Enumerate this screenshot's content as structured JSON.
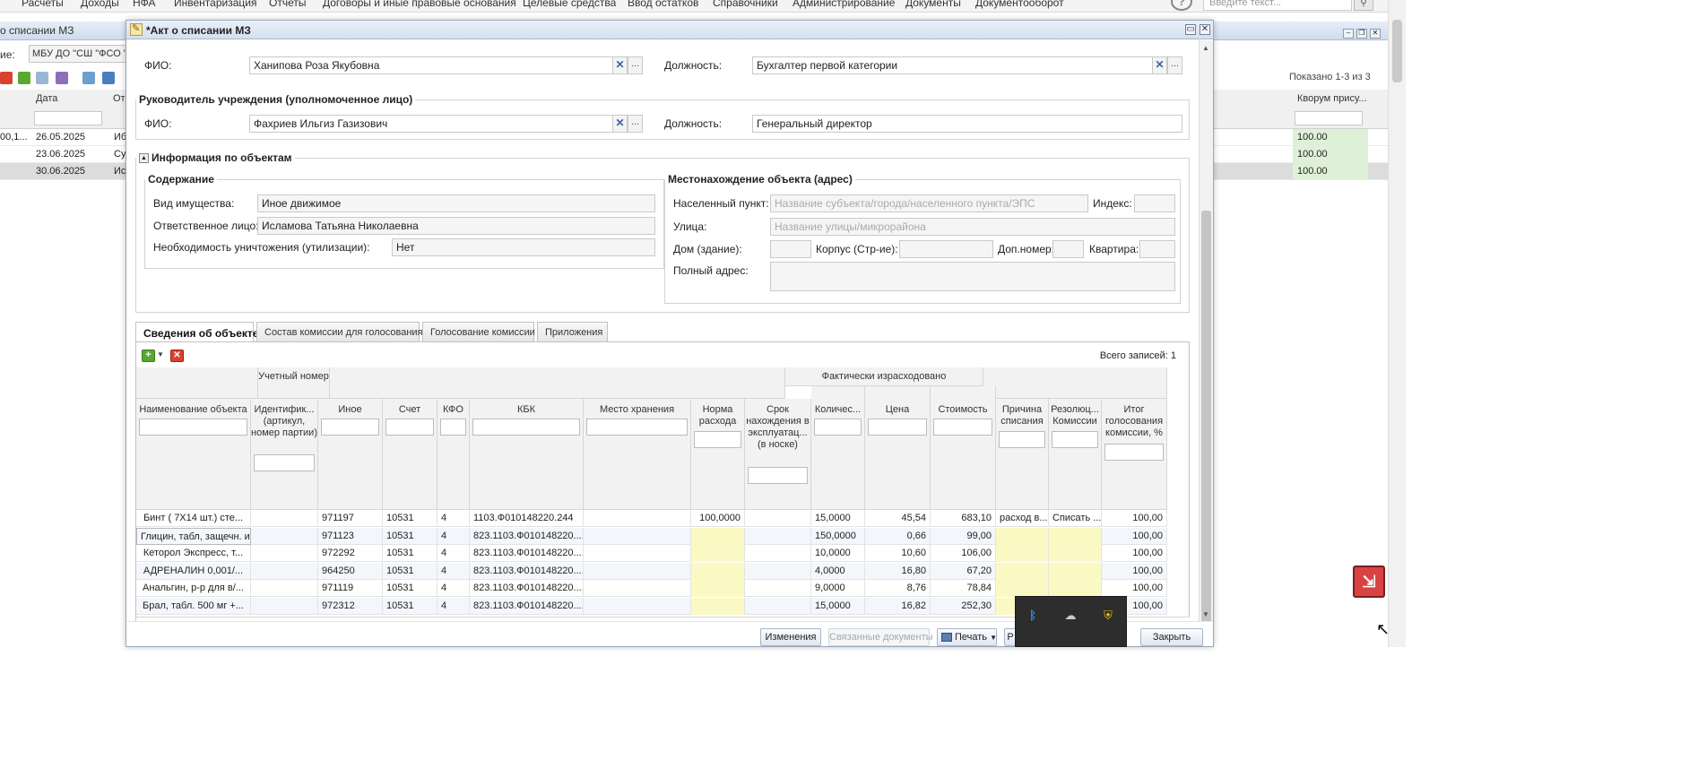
{
  "app": {
    "menu": [
      "Расчеты",
      "Доходы",
      "НФА",
      "Инвентаризация",
      "Отчеты",
      "Договоры и иные правовые основания",
      "Целевые средства",
      "Ввод остатков",
      "Справочники",
      "Администрирование",
      "Документы",
      "Документооборот"
    ],
    "help_icon": "?",
    "search_placeholder": "Введите текст...",
    "search_icon": "magnifier",
    "window_title": "о списании МЗ",
    "filter_label": "ие:",
    "filter_value": "МБУ ДО \"СШ \"ФСО \"",
    "shown_text": "Показано 1-3 из 3",
    "grid_headers": [
      "Дата",
      "От",
      "Кворум прису..."
    ],
    "rows": [
      {
        "c0": "00,1...",
        "date": "26.05.2025",
        "from": "Иб",
        "quorum": "100.00"
      },
      {
        "c0": "",
        "date": "23.06.2025",
        "from": "Су",
        "quorum": "100.00"
      },
      {
        "c0": "",
        "date": "30.06.2025",
        "from": "Ис",
        "quorum": "100.00"
      }
    ],
    "tray_app_icon": "app-icon"
  },
  "dialog": {
    "title": "*Акт о списании МЗ",
    "fio_label": "ФИО:",
    "position_label": "Должность:",
    "member": {
      "fio": "Ханипова Роза Якубовна",
      "position": "Бухгалтер первой категории"
    },
    "head_legend": "Руководитель учреждения (уполномоченное лицо)",
    "head": {
      "fio": "Фахриев Ильгиз Газизович",
      "position": "Генеральный директор"
    },
    "clear_symbol": "✕",
    "dots_symbol": "...",
    "info_legend": "Информация по объектам",
    "content": {
      "legend": "Содержание",
      "property_type_label": "Вид имущества:",
      "property_type": "Иное движимое",
      "responsible_label": "Ответственное лицо:",
      "responsible": "Исламова Татьяна Николаевна",
      "destroy_label": "Необходимость уничтожения (утилизации):",
      "destroy": "Нет"
    },
    "location": {
      "legend": "Местонахождение объекта (адрес)",
      "locality_label": "Населенный пункт:",
      "locality_placeholder": "Название субъекта/города/населенного пункта/ЭПС",
      "index_label": "Индекс:",
      "street_label": "Улица:",
      "street_placeholder": "Название улицы/микрорайона",
      "house_label": "Дом (здание):",
      "korpus_label": "Корпус (Стр-ие):",
      "dop_label": "Доп.номер:",
      "flat_label": "Квартира:",
      "full_label": "Полный адрес:"
    },
    "tabs": [
      "Сведения об объекте",
      "Состав комиссии для голосования",
      "Голосование комиссии",
      "Приложения"
    ],
    "total_records": "Всего записей:  1",
    "grid": {
      "band_account": "Учетный номер",
      "band_spent": "Фактически израсходовано",
      "headers": {
        "name": "Наименование объекта",
        "ident": "Идентифик... (артикул, номер партии)",
        "other": "Иное",
        "acct": "Счет",
        "kfo": "КФО",
        "kbk": "КБК",
        "place": "Место хранения",
        "norm": "Норма расхода",
        "term": "Срок нахождения в эксплуатац... (в носке)",
        "qty": "Количес...",
        "price": "Цена",
        "cost": "Стоимость",
        "reason": "Причина списания",
        "resol": "Резолюц... Комиссии",
        "result": "Итог голосования комиссии, %"
      },
      "rows": [
        {
          "name": "Бинт ( 7Х14 шт.) сте...",
          "ident": "",
          "other": "971197",
          "acct": "10531",
          "kfo": "4",
          "kbk": "1103.Ф010148220.244",
          "place": "",
          "norm": "100,0000",
          "term": "",
          "qty": "15,0000",
          "price": "45,54",
          "cost": "683,10",
          "reason": "расход в...",
          "resol": "Списать ...",
          "result": "100,00"
        },
        {
          "name": "Глицин, табл, защечн. и",
          "ident": "",
          "other": "971123",
          "acct": "10531",
          "kfo": "4",
          "kbk": "823.1103.Ф010148220....",
          "place": "",
          "norm": "",
          "term": "",
          "qty": "150,0000",
          "price": "0,66",
          "cost": "99,00",
          "reason": "",
          "resol": "",
          "result": "100,00"
        },
        {
          "name": "Кеторол Экспресс, т...",
          "ident": "",
          "other": "972292",
          "acct": "10531",
          "kfo": "4",
          "kbk": "823.1103.Ф010148220....",
          "place": "",
          "norm": "",
          "term": "",
          "qty": "10,0000",
          "price": "10,60",
          "cost": "106,00",
          "reason": "",
          "resol": "",
          "result": "100,00"
        },
        {
          "name": "АДРЕНАЛИН 0,001/...",
          "ident": "",
          "other": "964250",
          "acct": "10531",
          "kfo": "4",
          "kbk": "823.1103.Ф010148220....",
          "place": "",
          "norm": "",
          "term": "",
          "qty": "4,0000",
          "price": "16,80",
          "cost": "67,20",
          "reason": "",
          "resol": "",
          "result": "100,00"
        },
        {
          "name": "Анальгин, р-р для в/...",
          "ident": "",
          "other": "971119",
          "acct": "10531",
          "kfo": "4",
          "kbk": "823.1103.Ф010148220....",
          "place": "",
          "norm": "",
          "term": "",
          "qty": "9,0000",
          "price": "8,76",
          "cost": "78,84",
          "reason": "",
          "resol": "",
          "result": "100,00"
        },
        {
          "name": "Брал, табл. 500 мг +...",
          "ident": "",
          "other": "972312",
          "acct": "10531",
          "kfo": "4",
          "kbk": "823.1103.Ф010148220....",
          "place": "",
          "norm": "",
          "term": "",
          "qty": "15,0000",
          "price": "16,82",
          "cost": "252,30",
          "reason": "",
          "resol": "",
          "result": "100,00"
        }
      ]
    },
    "footer": {
      "changes": "Изменения",
      "linked": "Связанные документы",
      "print": "Печать",
      "save_partial": "Р",
      "close": "Закрыть"
    }
  },
  "tray": {
    "icons": [
      "bluetooth-icon",
      "cloud-offline-icon",
      "security-warning-icon"
    ]
  }
}
